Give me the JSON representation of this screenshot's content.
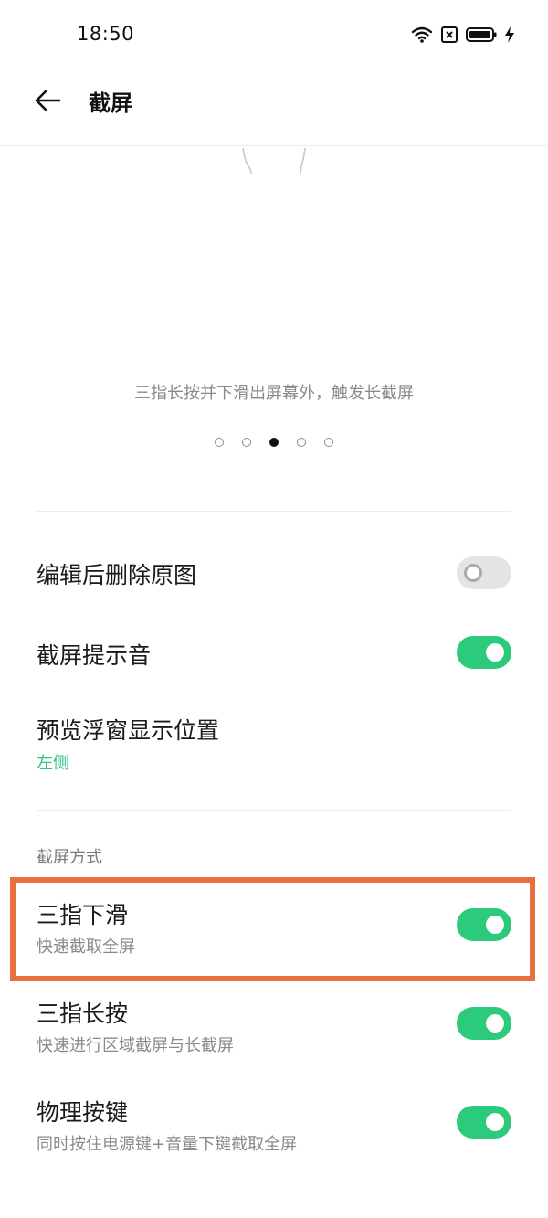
{
  "status_bar": {
    "time": "18:50",
    "icons": [
      "wifi-icon",
      "sim-error-icon",
      "battery-icon",
      "charging-icon"
    ]
  },
  "app_bar": {
    "back_icon": "arrow-left-icon",
    "title": "截屏"
  },
  "illustration": {
    "caption": "三指长按并下滑出屏幕外，触发长截屏"
  },
  "pager": {
    "count": 5,
    "active_index": 2
  },
  "settings": {
    "delete_original": {
      "title": "编辑后删除原图",
      "enabled": false
    },
    "screenshot_sound": {
      "title": "截屏提示音",
      "enabled": true
    },
    "preview_position": {
      "title": "预览浮窗显示位置",
      "value": "左侧"
    }
  },
  "methods_section": {
    "header": "截屏方式",
    "three_finger_swipe": {
      "title": "三指下滑",
      "subtitle": "快速截取全屏",
      "enabled": true
    },
    "three_finger_hold": {
      "title": "三指长按",
      "subtitle": "快速进行区域截屏与长截屏",
      "enabled": true
    },
    "physical_keys": {
      "title": "物理按键",
      "subtitle": "同时按住电源键+音量下键截取全屏",
      "enabled": true
    }
  },
  "colors": {
    "accent": "#2bcb7b",
    "highlight": "#e8703f"
  }
}
